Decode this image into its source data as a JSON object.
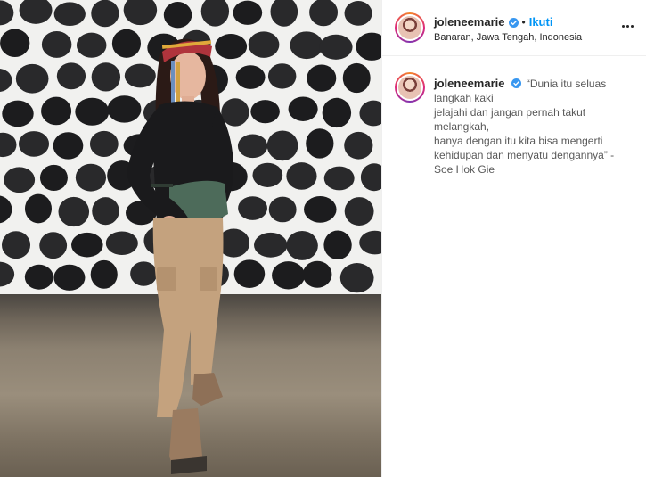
{
  "post": {
    "username": "joleneemarie",
    "verified": true,
    "separator": "•",
    "follow_label": "Ikuti",
    "location": "Banaran, Jawa Tengah, Indonesia",
    "more_icon": "more-options-icon",
    "caption_lines": [
      "“Dunia itu seluas",
      "langkah kaki",
      "jelajahi dan jangan pernah takut",
      "melangkah,",
      "hanya dengan itu kita bisa mengerti",
      "kehidupan dan menyatu dengannya” -",
      "Soe Hok Gie"
    ]
  },
  "colors": {
    "link": "#0095f6",
    "verified": "#3897f0",
    "text": "#262626",
    "border": "#efefef"
  }
}
